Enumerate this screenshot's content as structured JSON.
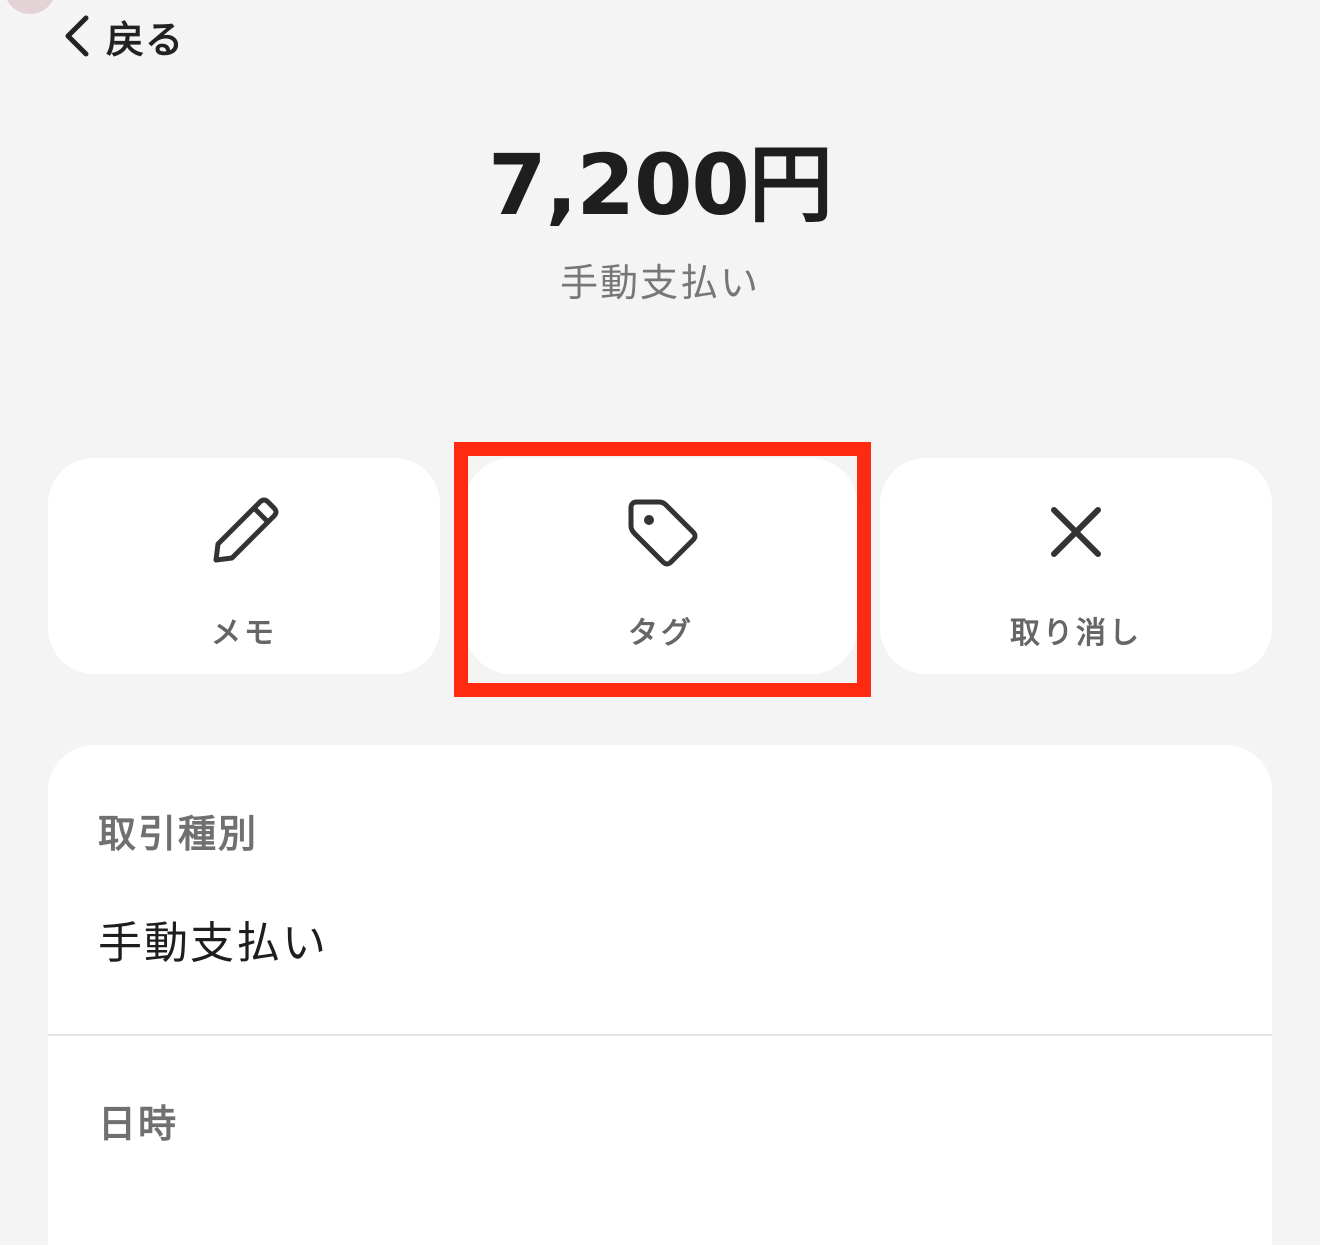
{
  "header": {
    "back_label": "戻る",
    "back_icon": "chevron-left-icon"
  },
  "summary": {
    "amount": "7,200円",
    "type": "手動支払い"
  },
  "actions": [
    {
      "label": "メモ",
      "icon": "pencil-icon"
    },
    {
      "label": "タグ",
      "icon": "tag-icon"
    },
    {
      "label": "取り消し",
      "icon": "close-icon"
    }
  ],
  "highlight_color": "#ff2a10",
  "details": {
    "transaction_type_title": "取引種別",
    "transaction_type_value": "手動支払い",
    "datetime_title": "日時"
  }
}
